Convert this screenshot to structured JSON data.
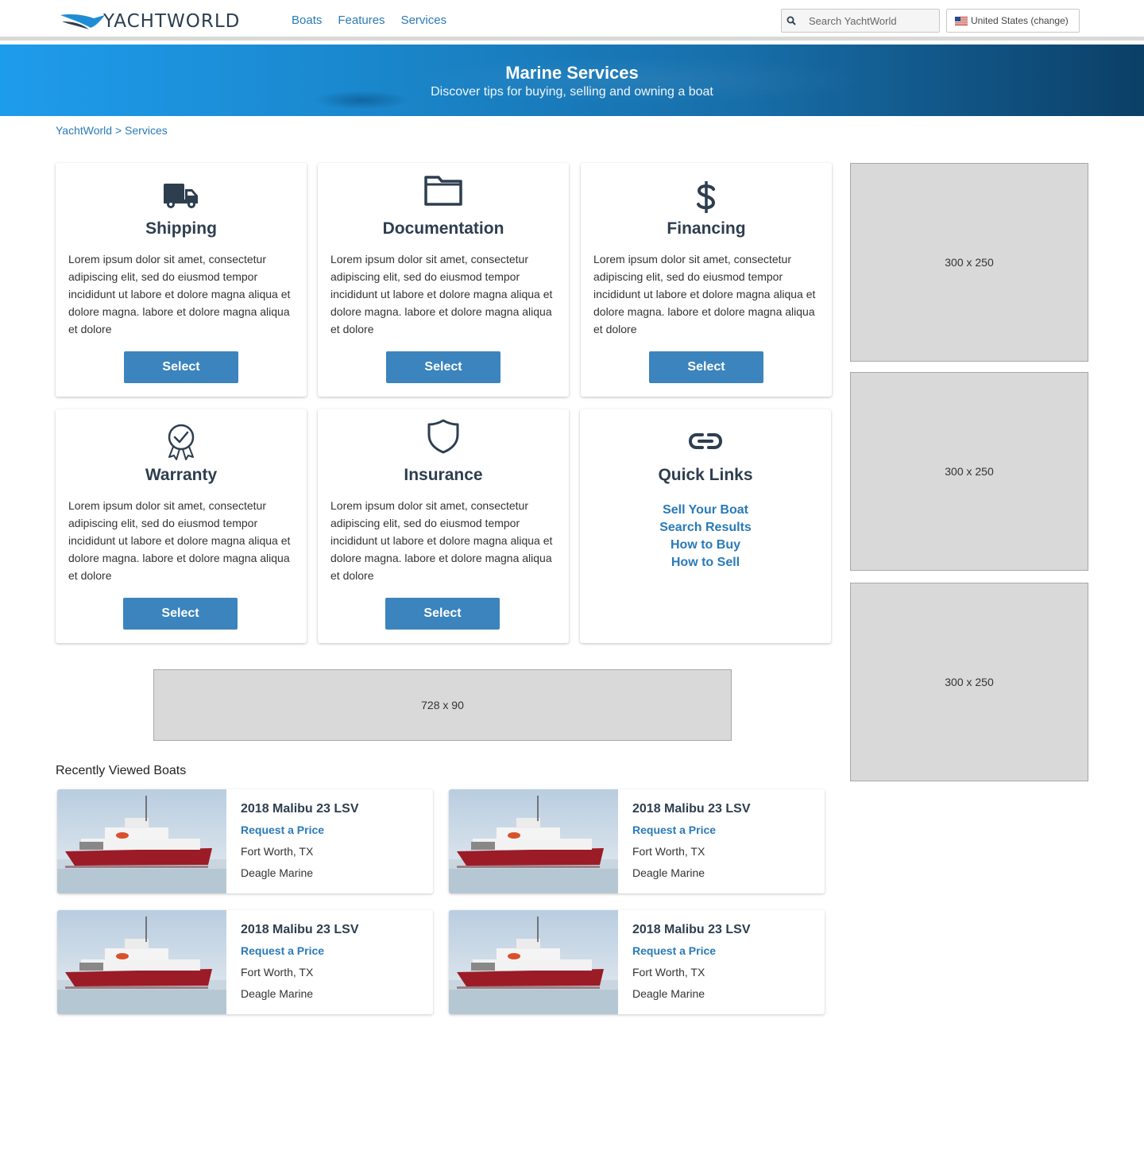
{
  "header": {
    "logo_text": "YACHTWORLD",
    "nav": [
      "Boats",
      "Features",
      "Services"
    ],
    "search_placeholder": "Search YachtWorld",
    "country_label": "United States (change)"
  },
  "hero": {
    "title": "Marine Services",
    "subtitle": "Discover tips for buying, selling and owning a boat"
  },
  "breadcrumb": {
    "home": "YachtWorld",
    "separator": " > ",
    "current": "Services"
  },
  "cards": [
    {
      "title": "Shipping",
      "icon": "truck-icon",
      "desc": "Lorem ipsum dolor sit amet, consectetur adipiscing elit, sed do eiusmod tempor incididunt ut labore et dolore magna aliqua et dolore magna.  labore et dolore magna aliqua et dolore",
      "button": "Select"
    },
    {
      "title": "Documentation",
      "icon": "folder-icon",
      "desc": "Lorem ipsum dolor sit amet, consectetur adipiscing elit, sed do eiusmod tempor incididunt ut labore et dolore magna aliqua et dolore magna.  labore et dolore magna aliqua et dolore",
      "button": "Select"
    },
    {
      "title": "Financing",
      "icon": "dollar-icon",
      "desc": "Lorem ipsum dolor sit amet, consectetur adipiscing elit, sed do eiusmod tempor incididunt ut labore et dolore magna aliqua et dolore magna.  labore et dolore magna aliqua et dolore",
      "button": "Select"
    },
    {
      "title": "Warranty",
      "icon": "award-ribbon-icon",
      "desc": "Lorem ipsum dolor sit amet, consectetur adipiscing elit, sed do eiusmod tempor incididunt ut labore et dolore magna aliqua et dolore magna.  labore et dolore magna aliqua et dolore",
      "button": "Select"
    },
    {
      "title": "Insurance",
      "icon": "shield-icon",
      "desc": "Lorem ipsum dolor sit amet, consectetur adipiscing elit, sed do eiusmod tempor incididunt ut labore et dolore magna aliqua et dolore magna.  labore et dolore magna aliqua et dolore",
      "button": "Select"
    }
  ],
  "quick_links": {
    "title": "Quick Links",
    "icon": "link-icon",
    "links": [
      "Sell Your Boat",
      "Search Results",
      "How to Buy",
      "How to Sell"
    ]
  },
  "ads": {
    "side": [
      "300 x 250",
      "300 x 250",
      "300 x 250"
    ],
    "banner": "728 x 90"
  },
  "recent": {
    "title": "Recently Viewed Boats",
    "boats": [
      {
        "name": "2018 Malibu 23 LSV",
        "price": "Request a Price",
        "location": "Fort Worth, TX",
        "dealer": "Deagle Marine"
      },
      {
        "name": "2018 Malibu 23 LSV",
        "price": "Request a Price",
        "location": "Fort Worth, TX",
        "dealer": "Deagle Marine"
      },
      {
        "name": "2018 Malibu 23 LSV",
        "price": "Request a Price",
        "location": "Fort Worth, TX",
        "dealer": "Deagle Marine"
      },
      {
        "name": "2018 Malibu 23 LSV",
        "price": "Request a Price",
        "location": "Fort Worth, TX",
        "dealer": "Deagle Marine"
      }
    ]
  },
  "colors": {
    "accent": "#3b84bd",
    "link": "#2a7ab8",
    "heading": "#2d3e4f",
    "ad_bg": "#d9d9d9"
  }
}
